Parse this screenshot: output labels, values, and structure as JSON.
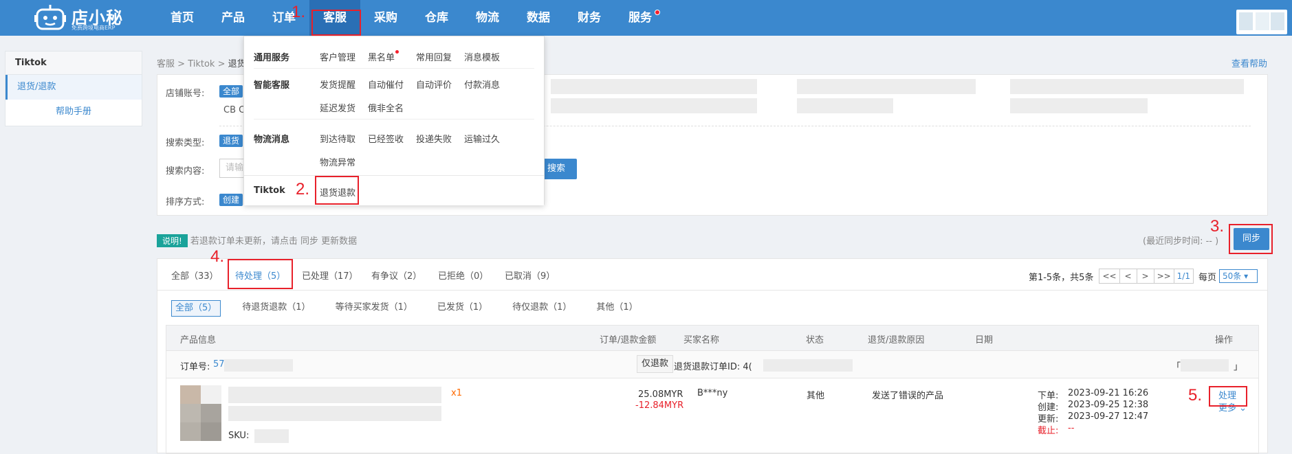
{
  "header": {
    "brand": "店小秘",
    "brand_sub": "免费跨境电商ERP",
    "nav": [
      "首页",
      "产品",
      "订单",
      "客服",
      "采购",
      "仓库",
      "物流",
      "数据",
      "财务",
      "服务"
    ],
    "active_nav": "客服"
  },
  "sidebar": {
    "title": "Tiktok",
    "item": "退货/退款",
    "help": "帮助手册"
  },
  "breadcrumb": {
    "part1": "客服",
    "sep": " > ",
    "part2": "Tiktok",
    "part3": "退货/退"
  },
  "help_link": "查看帮助",
  "filter": {
    "shop_label": "店铺账号:",
    "shop_chip": "全部",
    "shop_first": "CB C",
    "search_type_label": "搜索类型:",
    "search_type_chip": "退货",
    "search_content_label": "搜索内容:",
    "search_placeholder": "请输",
    "sort_label": "排序方式:",
    "sort_chip": "创建",
    "search_btn": "搜索"
  },
  "dropdown": {
    "general": {
      "cat": "通用服务",
      "links": [
        "客户管理",
        "黑名单",
        "常用回复",
        "消息模板"
      ]
    },
    "smart": {
      "cat": "智能客服",
      "links": [
        "发货提醒",
        "自动催付",
        "自动评价",
        "付款消息",
        "延迟发货",
        "俄非全名"
      ]
    },
    "logistics": {
      "cat": "物流消息",
      "links": [
        "到达待取",
        "已经签收",
        "投递失败",
        "运输过久",
        "物流异常"
      ]
    },
    "tiktok": {
      "cat": "Tiktok",
      "link": "退货退款"
    }
  },
  "annotations": [
    "1.",
    "2.",
    "3.",
    "4.",
    "5."
  ],
  "notice": {
    "tag": "说明!",
    "text": "若退款订单未更新，请点击 同步 更新数据"
  },
  "sync": {
    "text": "(最近同步时间:",
    "value": "-- )",
    "btn": "同步"
  },
  "tabs": [
    "全部（33）",
    "待处理（5）",
    "已处理（17）",
    "有争议（2）",
    "已拒绝（0）",
    "已取消（9）"
  ],
  "active_tab": "待处理（5）",
  "pager": {
    "info": "第1-5条，共5条",
    "first": "<<",
    "prev": "<",
    "next": ">",
    "last": ">>",
    "page": "1/1",
    "per_page_label": "每页",
    "per_page": "50条"
  },
  "subtabs": [
    "全部（5）",
    "待退货退款（1）",
    "等待买家发货（1）",
    "已发货（1）",
    "待仅退款（1）",
    "其他（1）"
  ],
  "table_headers": {
    "product": "产品信息",
    "amount": "订单/退款金额",
    "buyer": "买家名称",
    "status": "状态",
    "reason": "退货/退款原因",
    "date": "日期",
    "action": "操作"
  },
  "order": {
    "order_no_label": "订单号:",
    "order_no": "57",
    "refund_type": "仅退款",
    "refund_id_label": "退货退款订单ID: 4(",
    "bracket_left": "「",
    "bracket_right": "」"
  },
  "product": {
    "qty": "x1",
    "sku_label": "SKU:",
    "amount": "25.08MYR",
    "refund": "-12.84MYR",
    "buyer": "B***ny",
    "status": "其他",
    "reason": "发送了错误的产品",
    "dates": [
      {
        "label": "下单:",
        "value": "2023-09-21 16:26"
      },
      {
        "label": "创建:",
        "value": "2023-09-25 12:38"
      },
      {
        "label": "更新:",
        "value": "2023-09-27 12:47"
      }
    ],
    "deadline_label": "截止:",
    "deadline_value": "--",
    "action": "处理",
    "more": "更多"
  }
}
